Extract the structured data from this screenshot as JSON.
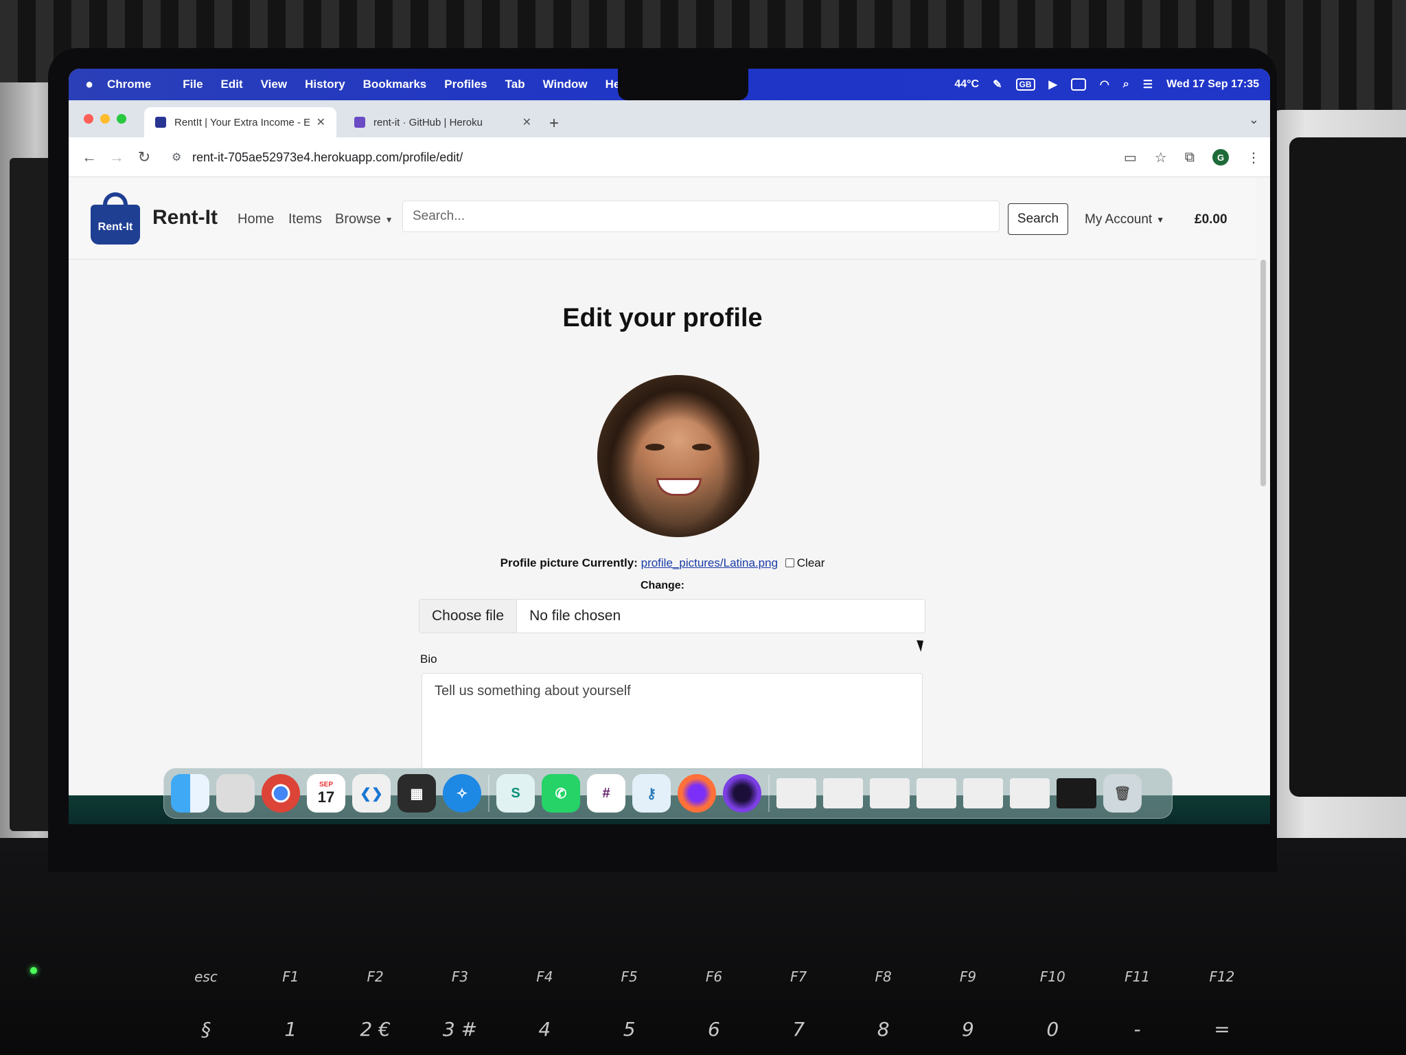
{
  "menubar": {
    "app_name": "Chrome",
    "items": [
      "File",
      "Edit",
      "View",
      "History",
      "Bookmarks",
      "Profiles",
      "Tab",
      "Window",
      "Help"
    ],
    "temperature": "44°C",
    "input_source": "GB",
    "datetime": "Wed 17 Sep  17:35"
  },
  "browser": {
    "tabs": [
      {
        "title": "RentIt | Your Extra Income - E",
        "active": true
      },
      {
        "title": "rent-it · GitHub | Heroku",
        "active": false
      }
    ],
    "url": "rent-it-705ae52973e4.herokuapp.com/profile/edit/",
    "profile_initial": "G"
  },
  "site": {
    "logo_text": "Rent-It",
    "brand": "Rent-It",
    "nav": {
      "home": "Home",
      "items": "Items",
      "browse": "Browse"
    },
    "search_placeholder": "Search...",
    "search_button": "Search",
    "account": "My Account",
    "basket_total": "£0.00"
  },
  "form": {
    "title": "Edit your profile",
    "picture_label": "Profile picture Currently:",
    "picture_link": "profile_pictures/Latina.png",
    "clear_label": "Clear",
    "change_label": "Change:",
    "choose_file": "Choose file",
    "no_file": "No file chosen",
    "bio_label": "Bio",
    "bio_placeholder": "Tell us something about yourself"
  },
  "dock": {
    "calendar_month": "SEP",
    "calendar_day": "17"
  },
  "keyboard": {
    "fn_row": [
      "esc",
      "F1",
      "F2",
      "F3",
      "F4",
      "F5",
      "F6",
      "F7",
      "F8",
      "F9",
      "F10",
      "F11",
      "F12"
    ],
    "num_row": [
      "§",
      "1",
      "2 €",
      "3 #",
      "4",
      "5",
      "6",
      "7",
      "8",
      "9",
      "0",
      "-",
      "="
    ]
  }
}
